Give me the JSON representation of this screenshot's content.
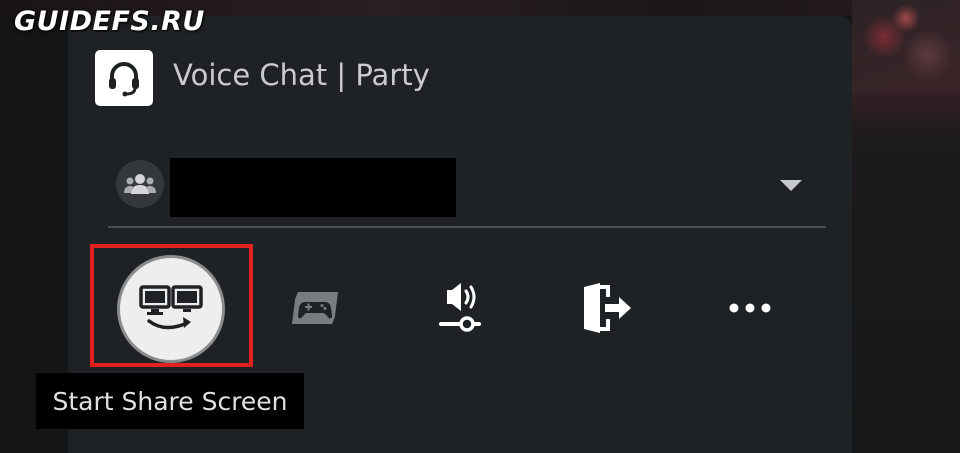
{
  "watermark": "GUIDEFS.RU",
  "header": {
    "app_icon": "headset-icon",
    "title": "Voice Chat | Party"
  },
  "party": {
    "avatar_icon": "group-icon",
    "name_redacted": true,
    "dropdown_icon": "chevron-down-icon"
  },
  "actions": [
    {
      "id": "share-screen",
      "icon": "share-screen-icon",
      "highlighted": true
    },
    {
      "id": "game-base",
      "icon": "gamepad-card-icon"
    },
    {
      "id": "audio-settings",
      "icon": "volume-slider-icon"
    },
    {
      "id": "leave-party",
      "icon": "exit-door-icon"
    },
    {
      "id": "more-options",
      "icon": "more-icon"
    }
  ],
  "tooltip": {
    "text": "Start Share Screen"
  },
  "colors": {
    "highlight": "#e32020",
    "panel": "#1f2224",
    "icon": "#ffffff"
  }
}
